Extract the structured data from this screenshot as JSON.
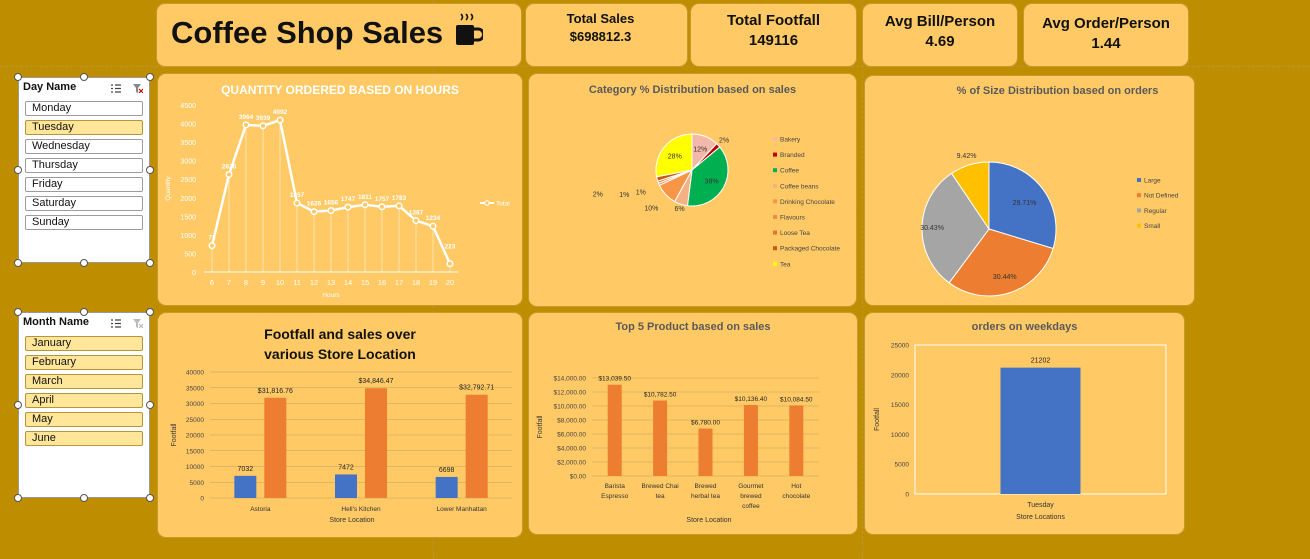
{
  "title": "Coffee Shop Sales",
  "kpis": [
    {
      "label": "Total Sales",
      "value": "$698812.3"
    },
    {
      "label": "Total Footfall",
      "value": "149116"
    },
    {
      "label": "Avg Bill/Person",
      "value": "4.69"
    },
    {
      "label": "Avg Order/Person",
      "value": "1.44"
    }
  ],
  "day_slicer": {
    "header": "Day Name",
    "items": [
      "Monday",
      "Tuesday",
      "Wednesday",
      "Thursday",
      "Friday",
      "Saturday",
      "Sunday"
    ],
    "selected": "Tuesday"
  },
  "month_slicer": {
    "header": "Month Name",
    "items": [
      "January",
      "February",
      "March",
      "April",
      "May",
      "June"
    ]
  },
  "colors": {
    "background": "#BF8E00",
    "card": "#FFCA66",
    "blue": "#4472C4",
    "orange": "#ED7D31",
    "gray": "#A5A5A5",
    "yellow": "#FFC000"
  },
  "chart_data": [
    {
      "type": "line",
      "title": "QUANTITY ORDERED BASED ON HOURS",
      "xlabel": "Hours",
      "ylabel": "Quantity",
      "x": [
        "6",
        "7",
        "8",
        "9",
        "10",
        "11",
        "12",
        "13",
        "14",
        "15",
        "16",
        "17",
        "18",
        "19",
        "20"
      ],
      "series": [
        {
          "name": "Total",
          "values": [
            710,
            2626,
            3964,
            3939,
            4092,
            1857,
            1626,
            1656,
            1747,
            1811,
            1757,
            1783,
            1387,
            1234,
            223
          ]
        }
      ],
      "data_labels": [
        "71",
        "2626",
        "3964",
        "3939",
        "4092",
        "1857",
        "1626",
        "1656",
        "1747",
        "1811",
        "1757",
        "1783",
        "1387",
        "1234",
        "223"
      ],
      "yticks": [
        "0",
        "500",
        "1000",
        "1500",
        "2000",
        "2500",
        "3000",
        "3500",
        "4000",
        "4500"
      ],
      "ylim": [
        0,
        4500
      ],
      "legend": "right"
    },
    {
      "type": "pie",
      "title": "Category % Distribution based on sales",
      "slices": [
        {
          "label": "Bakery",
          "value": 12,
          "color": "#F4B8A8",
          "text": "12%"
        },
        {
          "label": "Branded",
          "value": 2,
          "color": "#C00000",
          "text": "2%"
        },
        {
          "label": "Coffee",
          "value": 38,
          "color": "#00B050",
          "text": "38%"
        },
        {
          "label": "Coffee beans",
          "value": 6,
          "color": "#F4B183",
          "text": "6%"
        },
        {
          "label": "Drinking Chocolate",
          "value": 10,
          "color": "#F79646",
          "text": "10%"
        },
        {
          "label": "Flavours",
          "value": 1,
          "color": "#F08A4B",
          "text": "1%"
        },
        {
          "label": "Loose Tea",
          "value": 1,
          "color": "#E97132",
          "text": "1%"
        },
        {
          "label": "Packaged Chocolate",
          "value": 2,
          "color": "#C55A11",
          "text": "2%"
        },
        {
          "label": "Tea",
          "value": 28,
          "color": "#FFFF00",
          "text": "28%"
        }
      ],
      "legend": "right"
    },
    {
      "type": "pie",
      "title": "% of Size Distribution based on orders",
      "slices": [
        {
          "label": "Large",
          "value": 29.71,
          "color": "#4472C4",
          "text": "29.71%"
        },
        {
          "label": "Not Defined",
          "value": 30.44,
          "color": "#ED7D31",
          "text": "30.44%"
        },
        {
          "label": "Regular",
          "value": 30.43,
          "color": "#A5A5A5",
          "text": "30.43%"
        },
        {
          "label": "Small",
          "value": 9.42,
          "color": "#FFC000",
          "text": "9.42%"
        }
      ],
      "legend": "right"
    },
    {
      "type": "bar",
      "title": "Footfall and sales over various Store Location",
      "xlabel": "Store Location",
      "ylabel": "Footfall",
      "categories": [
        "Astoria",
        "Hell's Kitchen",
        "Lower Manhattan"
      ],
      "series": [
        {
          "values": [
            7032,
            7472,
            6698
          ],
          "labels": [
            "7032",
            "7472",
            "6698"
          ],
          "color": "#4472C4"
        },
        {
          "values": [
            31816.76,
            34846.47,
            32792.71
          ],
          "labels": [
            "$31,816.76",
            "$34,846.47",
            "$32,792.71"
          ],
          "color": "#ED7D31"
        }
      ],
      "yticks": [
        "0",
        "5000",
        "10000",
        "15000",
        "20000",
        "25000",
        "30000",
        "35000",
        "40000"
      ],
      "ylim": [
        0,
        40000
      ]
    },
    {
      "type": "bar",
      "title": "Top 5 Product based on sales",
      "xlabel": "Store Location",
      "ylabel": "Footfall",
      "categories": [
        [
          "Barista",
          "Espresso"
        ],
        [
          "Brewed Chai",
          "tea"
        ],
        [
          "Brewed",
          "herbal tea"
        ],
        [
          "Gourmet",
          "brewed",
          "coffee"
        ],
        [
          "Hot",
          "chocolate"
        ]
      ],
      "values": [
        13039.5,
        10782.5,
        6780.0,
        10136.4,
        10084.5
      ],
      "labels": [
        "$13,039.50",
        "$10,782.50",
        "$6,780.00",
        "$10,136.40",
        "$10,084.50"
      ],
      "yticks": [
        "$0.00",
        "$2,000.00",
        "$4,000.00",
        "$6,000.00",
        "$8,000.00",
        "$10,000.00",
        "$12,000.00",
        "$14,000.00"
      ],
      "ylim": [
        0,
        14000
      ]
    },
    {
      "type": "bar",
      "title": "orders on weekdays",
      "xlabel": "Store Locations",
      "ylabel": "Footfall",
      "categories": [
        "Tuesday"
      ],
      "values": [
        21202
      ],
      "labels": [
        "21202"
      ],
      "yticks": [
        "0",
        "5000",
        "10000",
        "15000",
        "20000",
        "25000"
      ],
      "ylim": [
        0,
        25000
      ]
    }
  ]
}
